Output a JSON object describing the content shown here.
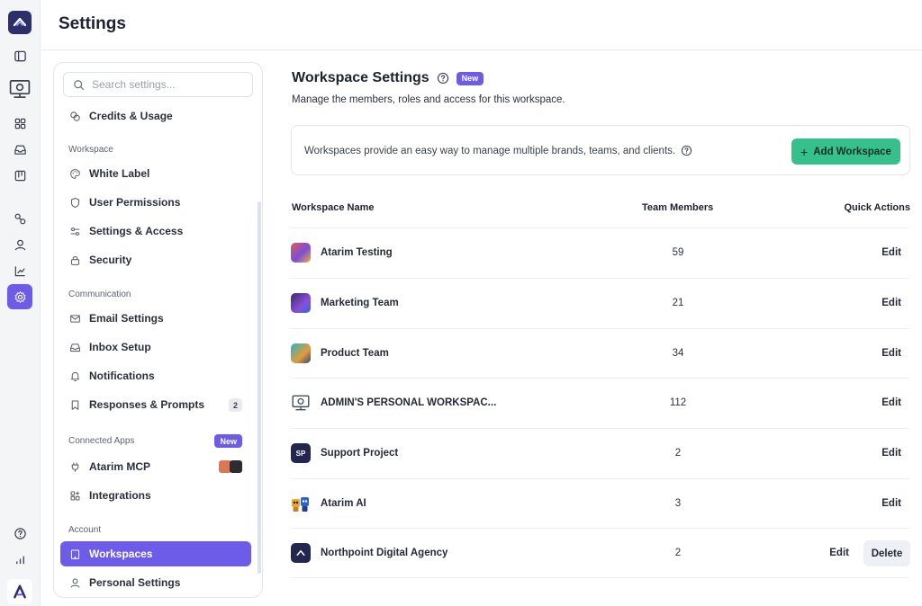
{
  "header": {
    "title": "Settings"
  },
  "colors": {
    "accent": "#6c5ce7",
    "success": "#36c08c",
    "brand_dark": "#2d2f6b"
  },
  "rail": {
    "icons": [
      "sidebar-toggle-icon",
      "workspace-icon",
      "grid-icon",
      "inbox-icon",
      "board-icon",
      "link-icon",
      "user-icon",
      "chart-icon",
      "settings-icon",
      "help-icon",
      "analytics-icon"
    ],
    "active": "settings-icon"
  },
  "sidebar": {
    "search_placeholder": "Search settings...",
    "credits": "Credits & Usage",
    "section_workspace": "Workspace",
    "white_label": "White Label",
    "user_permissions": "User Permissions",
    "settings_access": "Settings & Access",
    "security": "Security",
    "section_communication": "Communication",
    "email_settings": "Email Settings",
    "inbox_setup": "Inbox Setup",
    "notifications": "Notifications",
    "responses_prompts": "Responses & Prompts",
    "responses_count": "2",
    "section_connected": "Connected Apps",
    "connected_badge": "New",
    "atarim_mcp": "Atarim MCP",
    "integrations": "Integrations",
    "section_account": "Account",
    "workspaces": "Workspaces",
    "personal_settings": "Personal Settings"
  },
  "main": {
    "title": "Workspace Settings",
    "title_badge": "New",
    "subtitle": "Manage the members, roles and access for this workspace.",
    "info": "Workspaces provide an easy way to manage multiple brands, teams, and clients.",
    "add_button": "Add Workspace",
    "columns": {
      "name": "Workspace Name",
      "members": "Team Members",
      "actions": "Quick Actions"
    },
    "rows": [
      {
        "name": "Atarim Testing",
        "members": "59",
        "edit": "Edit"
      },
      {
        "name": "Marketing Team",
        "members": "21",
        "edit": "Edit"
      },
      {
        "name": "Product Team",
        "members": "34",
        "edit": "Edit"
      },
      {
        "name": "ADMIN'S PERSONAL WORKSPAC...",
        "members": "112",
        "edit": "Edit"
      },
      {
        "name": "Support Project",
        "members": "2",
        "edit": "Edit",
        "initials": "SP"
      },
      {
        "name": "Atarim AI",
        "members": "3",
        "edit": "Edit"
      },
      {
        "name": "Northpoint Digital Agency",
        "members": "2",
        "edit": "Edit",
        "delete": "Delete"
      }
    ]
  }
}
